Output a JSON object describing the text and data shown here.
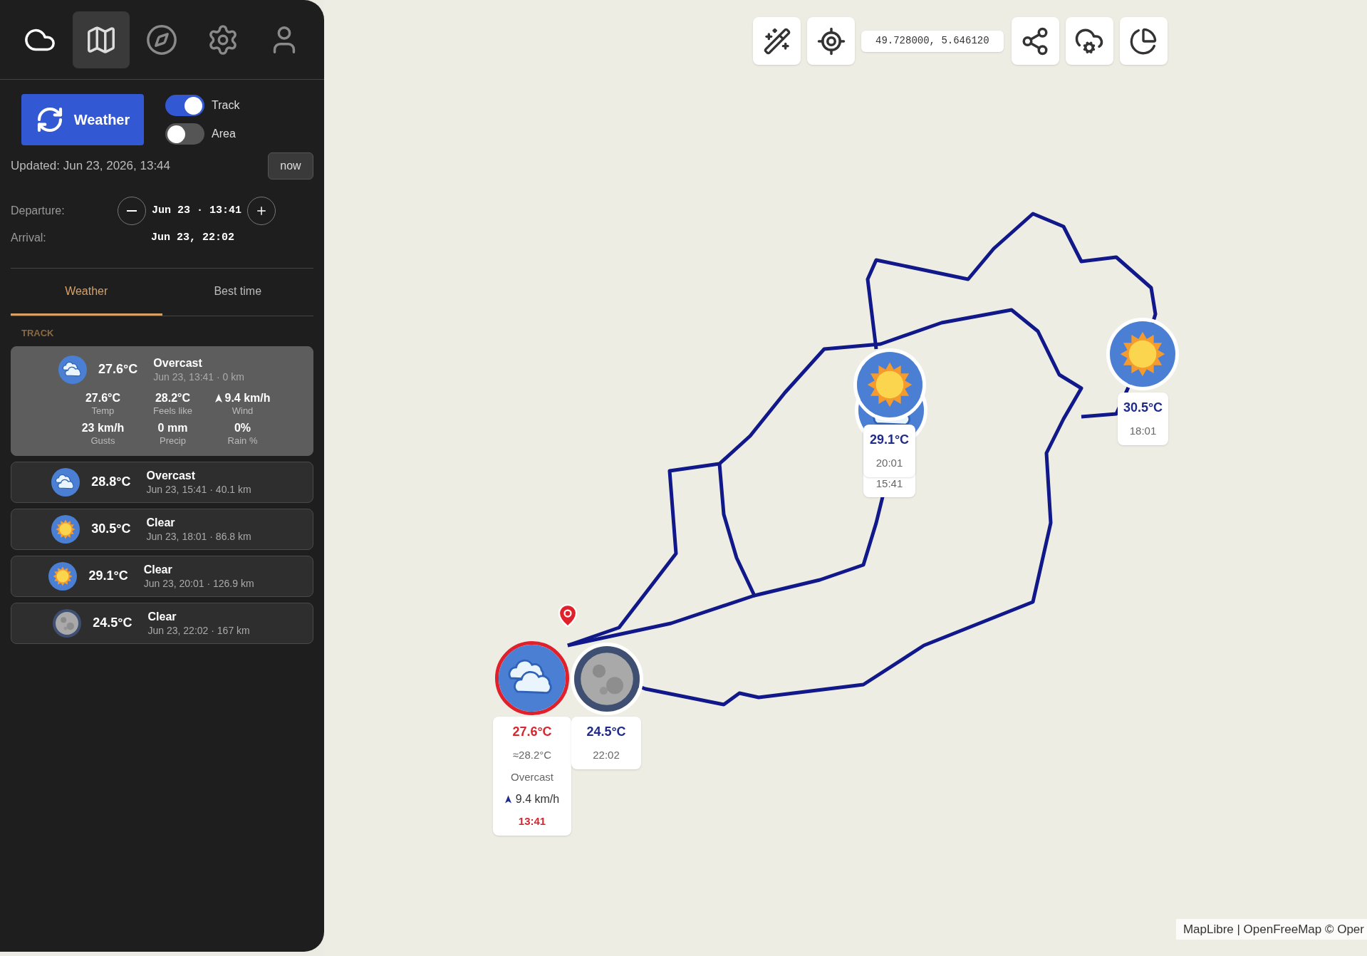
{
  "sidebar": {
    "nav": [
      {
        "selected": false
      },
      {
        "selected": true
      },
      {
        "selected": false
      },
      {
        "selected": false
      },
      {
        "selected": false
      }
    ],
    "refresh_button": "Weather",
    "toggles": [
      {
        "label": "Track",
        "on": true
      },
      {
        "label": "Area",
        "on": false
      }
    ],
    "updated": "Updated: Jun 23, 2026, 13:44",
    "now_button": "now",
    "departure": {
      "label": "Departure:",
      "value": "Jun 23 · 13:41"
    },
    "arrival": {
      "label": "Arrival:",
      "value": "Jun 23, 22:02"
    },
    "tabs": [
      {
        "label": "Weather",
        "selected": true
      },
      {
        "label": "Best time",
        "selected": false
      }
    ],
    "section": "TRACK",
    "forecasts": [
      {
        "kind": "cloud",
        "temp": "27.6°C",
        "condition": "Overcast",
        "meta": "Jun 23, 13:41 · 0 km",
        "selected": true,
        "details": [
          {
            "kind": "plain",
            "value": "27.6°C",
            "label": "Temp"
          },
          {
            "kind": "plain",
            "value": "28.2°C",
            "label": "Feels like"
          },
          {
            "kind": "wind",
            "value": "9.4 km/h",
            "label": "Wind"
          },
          {
            "kind": "plain",
            "value": "23 km/h",
            "label": "Gusts"
          },
          {
            "kind": "plain",
            "value": "0 mm",
            "label": "Precip"
          },
          {
            "kind": "plain",
            "value": "0%",
            "label": "Rain %"
          }
        ]
      },
      {
        "kind": "cloud",
        "temp": "28.8°C",
        "condition": "Overcast",
        "meta": "Jun 23, 15:41 · 40.1 km",
        "selected": false
      },
      {
        "kind": "sun",
        "temp": "30.5°C",
        "condition": "Clear",
        "meta": "Jun 23, 18:01 · 86.8 km",
        "selected": false
      },
      {
        "kind": "sun",
        "temp": "29.1°C",
        "condition": "Clear",
        "meta": "Jun 23, 20:01 · 126.9 km",
        "selected": false
      },
      {
        "kind": "moon",
        "temp": "24.5°C",
        "condition": "Clear",
        "meta": "Jun 23, 22:02 · 167 km",
        "selected": false
      }
    ]
  },
  "map": {
    "coordinates": "49.728000, 5.646120",
    "markers": [
      {
        "kind": "cloud",
        "selected": true,
        "temp": "27.6°C",
        "feels": "≈28.2°C",
        "condition": "Overcast",
        "wind": "9.4 km/h",
        "time": "13:41"
      },
      {
        "kind": "moon",
        "selected": false,
        "temp": "24.5°C",
        "time": "22:02"
      },
      {
        "kind": "cloud",
        "selected": false,
        "time": "15:41"
      },
      {
        "kind": "sun",
        "selected": false,
        "temp": "29.1°C",
        "time": "20:01"
      },
      {
        "kind": "sun",
        "selected": false,
        "temp": "30.5°C",
        "time": "18:01"
      }
    ],
    "attribution": "MapLibre | OpenFreeMap © Oper"
  }
}
